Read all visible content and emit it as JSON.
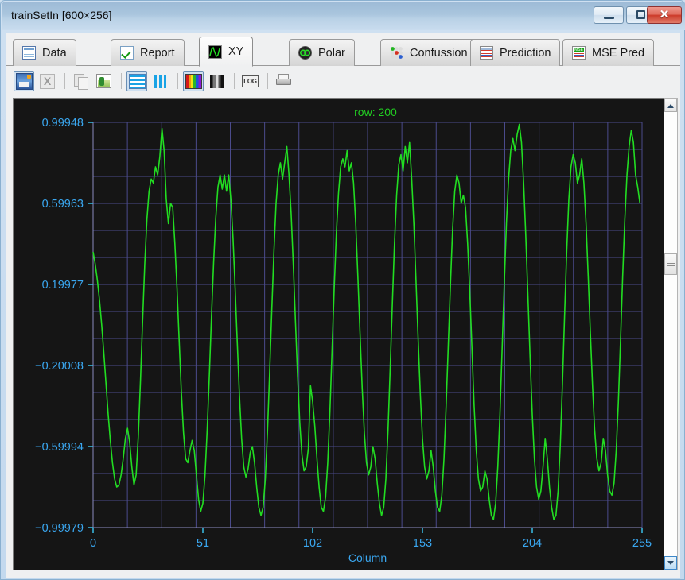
{
  "window": {
    "title": "trainSetIn [600×256]",
    "controls": {
      "minimize": "–",
      "maximize": "□",
      "close": "✕"
    }
  },
  "tabs": [
    {
      "label": "Data",
      "icon": "table-grid-icon",
      "active": false
    },
    {
      "label": "Report",
      "icon": "green-check-icon",
      "active": false
    },
    {
      "label": "XY",
      "icon": "xy-waveform-icon",
      "active": true
    },
    {
      "label": "Polar",
      "icon": "polar-infinity-icon",
      "active": false
    },
    {
      "label": "Confussion",
      "icon": "confusion-dots-icon",
      "active": false
    },
    {
      "label": "Prediction",
      "icon": "prediction-grid-icon",
      "active": false
    },
    {
      "label": "MSE Pred",
      "icon": "mse-grid-icon",
      "active": false
    }
  ],
  "toolbar": {
    "buttons": [
      {
        "name": "save-image-button",
        "icon": "save-image-icon",
        "enabled": true,
        "selected": false
      },
      {
        "name": "export-excel-button",
        "icon": "excel-sheet-icon",
        "enabled": false,
        "selected": false
      },
      {
        "name": "copy-button",
        "icon": "copy-pages-icon",
        "enabled": false,
        "selected": false
      },
      {
        "name": "copy-image-button",
        "icon": "copy-image-icon",
        "enabled": true,
        "selected": false
      },
      {
        "name": "horizontal-lines-button",
        "icon": "horizontal-lines-icon",
        "enabled": true,
        "selected": true
      },
      {
        "name": "vertical-bars-button",
        "icon": "vertical-bars-icon",
        "enabled": true,
        "selected": false
      },
      {
        "name": "color-palette-button",
        "icon": "color-palette-icon",
        "enabled": true,
        "selected": true
      },
      {
        "name": "gray-palette-button",
        "icon": "gray-palette-icon",
        "enabled": true,
        "selected": false
      },
      {
        "name": "log-scale-button",
        "icon": "log-icon",
        "enabled": true,
        "selected": false
      },
      {
        "name": "print-button",
        "icon": "printer-icon",
        "enabled": true,
        "selected": false
      }
    ],
    "log_label": "LOG",
    "excel_label": "X"
  },
  "mse_icon_label": "MSE",
  "scrollbar": {
    "up_arrow": "up-arrow-icon",
    "down_arrow": "down-arrow-icon",
    "thumb": "scroll-thumb"
  },
  "chart_data": {
    "type": "line",
    "title": "row: 200",
    "xlabel": "Column",
    "ylabel": "",
    "xlim": [
      0,
      255
    ],
    "ylim": [
      -0.99979,
      0.99948
    ],
    "grid": true,
    "legend": "none",
    "colors": {
      "background": "#151515",
      "grid": "#4b4b8c",
      "axis": "#8a8ac0",
      "tick_text": "#3aa7f0",
      "series": "#22dd22",
      "title": "#22cc22"
    },
    "xticks": [
      0,
      51,
      102,
      153,
      204,
      255
    ],
    "xtick_labels": [
      "0",
      "51",
      "102",
      "153",
      "204",
      "255"
    ],
    "yticks": [
      0.99948,
      0.59963,
      0.19977,
      -0.20008,
      -0.59994,
      -0.99979
    ],
    "ytick_labels": [
      "0.99948",
      "0.59963",
      "0.19977",
      "−0.20008",
      "−0.59994",
      "−0.99979"
    ],
    "series": [
      {
        "name": "row 200",
        "x": [
          0,
          1,
          2,
          3,
          4,
          5,
          6,
          7,
          8,
          9,
          10,
          11,
          12,
          13,
          14,
          15,
          16,
          17,
          18,
          19,
          20,
          21,
          22,
          23,
          24,
          25,
          26,
          27,
          28,
          29,
          30,
          31,
          32,
          33,
          34,
          35,
          36,
          37,
          38,
          39,
          40,
          41,
          42,
          43,
          44,
          45,
          46,
          47,
          48,
          49,
          50,
          51,
          52,
          53,
          54,
          55,
          56,
          57,
          58,
          59,
          60,
          61,
          62,
          63,
          64,
          65,
          66,
          67,
          68,
          69,
          70,
          71,
          72,
          73,
          74,
          75,
          76,
          77,
          78,
          79,
          80,
          81,
          82,
          83,
          84,
          85,
          86,
          87,
          88,
          89,
          90,
          91,
          92,
          93,
          94,
          95,
          96,
          97,
          98,
          99,
          100,
          101,
          102,
          103,
          104,
          105,
          106,
          107,
          108,
          109,
          110,
          111,
          112,
          113,
          114,
          115,
          116,
          117,
          118,
          119,
          120,
          121,
          122,
          123,
          124,
          125,
          126,
          127,
          128,
          129,
          130,
          131,
          132,
          133,
          134,
          135,
          136,
          137,
          138,
          139,
          140,
          141,
          142,
          143,
          144,
          145,
          146,
          147,
          148,
          149,
          150,
          151,
          152,
          153,
          154,
          155,
          156,
          157,
          158,
          159,
          160,
          161,
          162,
          163,
          164,
          165,
          166,
          167,
          168,
          169,
          170,
          171,
          172,
          173,
          174,
          175,
          176,
          177,
          178,
          179,
          180,
          181,
          182,
          183,
          184,
          185,
          186,
          187,
          188,
          189,
          190,
          191,
          192,
          193,
          194,
          195,
          196,
          197,
          198,
          199,
          200,
          201,
          202,
          203,
          204,
          205,
          206,
          207,
          208,
          209,
          210,
          211,
          212,
          213,
          214,
          215,
          216,
          217,
          218,
          219,
          220,
          221,
          222,
          223,
          224,
          225,
          226,
          227,
          228,
          229,
          230,
          231,
          232,
          233,
          234,
          235,
          236,
          237,
          238,
          239,
          240,
          241,
          242,
          243,
          244,
          245,
          246,
          247,
          248,
          249,
          250,
          251,
          252,
          253,
          254,
          255
        ],
        "y": [
          0.36,
          0.3,
          0.22,
          0.12,
          0.0,
          -0.14,
          -0.29,
          -0.44,
          -0.57,
          -0.68,
          -0.76,
          -0.8,
          -0.79,
          -0.74,
          -0.66,
          -0.56,
          -0.51,
          -0.58,
          -0.7,
          -0.79,
          -0.74,
          -0.55,
          -0.28,
          0.02,
          0.3,
          0.52,
          0.66,
          0.72,
          0.7,
          0.78,
          0.74,
          0.83,
          0.97,
          0.86,
          0.62,
          0.5,
          0.6,
          0.58,
          0.4,
          0.18,
          -0.08,
          -0.33,
          -0.53,
          -0.66,
          -0.68,
          -0.62,
          -0.57,
          -0.62,
          -0.74,
          -0.86,
          -0.92,
          -0.88,
          -0.74,
          -0.52,
          -0.25,
          0.04,
          0.31,
          0.53,
          0.68,
          0.74,
          0.67,
          0.74,
          0.66,
          0.74,
          0.62,
          0.43,
          0.18,
          -0.09,
          -0.35,
          -0.56,
          -0.7,
          -0.75,
          -0.71,
          -0.63,
          -0.6,
          -0.68,
          -0.8,
          -0.9,
          -0.94,
          -0.9,
          -0.76,
          -0.53,
          -0.24,
          0.07,
          0.36,
          0.6,
          0.74,
          0.8,
          0.72,
          0.8,
          0.88,
          0.74,
          0.55,
          0.3,
          0.02,
          -0.25,
          -0.48,
          -0.64,
          -0.72,
          -0.7,
          -0.61,
          -0.3,
          -0.38,
          -0.5,
          -0.66,
          -0.8,
          -0.9,
          -0.92,
          -0.85,
          -0.68,
          -0.43,
          -0.13,
          0.18,
          0.45,
          0.65,
          0.78,
          0.82,
          0.78,
          0.86,
          0.76,
          0.8,
          0.7,
          0.5,
          0.24,
          -0.04,
          -0.31,
          -0.53,
          -0.68,
          -0.74,
          -0.7,
          -0.6,
          -0.66,
          -0.78,
          -0.88,
          -0.94,
          -0.9,
          -0.76,
          -0.52,
          -0.22,
          0.1,
          0.4,
          0.64,
          0.79,
          0.84,
          0.76,
          0.88,
          0.8,
          0.9,
          0.72,
          0.5,
          0.22,
          -0.07,
          -0.34,
          -0.56,
          -0.7,
          -0.76,
          -0.72,
          -0.62,
          -0.7,
          -0.82,
          -0.9,
          -0.92,
          -0.84,
          -0.66,
          -0.4,
          -0.1,
          0.2,
          0.47,
          0.66,
          0.74,
          0.7,
          0.6,
          0.64,
          0.58,
          0.4,
          0.16,
          -0.12,
          -0.4,
          -0.62,
          -0.76,
          -0.82,
          -0.8,
          -0.72,
          -0.76,
          -0.86,
          -0.94,
          -0.96,
          -0.88,
          -0.7,
          -0.44,
          -0.12,
          0.2,
          0.5,
          0.72,
          0.86,
          0.92,
          0.86,
          0.94,
          0.99,
          0.9,
          0.7,
          0.44,
          0.14,
          -0.16,
          -0.44,
          -0.66,
          -0.8,
          -0.86,
          -0.82,
          -0.7,
          -0.56,
          -0.66,
          -0.8,
          -0.9,
          -0.96,
          -0.94,
          -0.82,
          -0.6,
          -0.3,
          0.04,
          0.36,
          0.62,
          0.78,
          0.84,
          0.8,
          0.7,
          0.74,
          0.82,
          0.7,
          0.5,
          0.24,
          -0.04,
          -0.3,
          -0.52,
          -0.66,
          -0.72,
          -0.68,
          -0.56,
          -0.62,
          -0.74,
          -0.82,
          -0.84,
          -0.78,
          -0.62,
          -0.38,
          -0.08,
          0.24,
          0.52,
          0.74,
          0.88,
          0.96,
          0.9,
          0.74,
          0.68,
          0.6
        ]
      }
    ]
  }
}
